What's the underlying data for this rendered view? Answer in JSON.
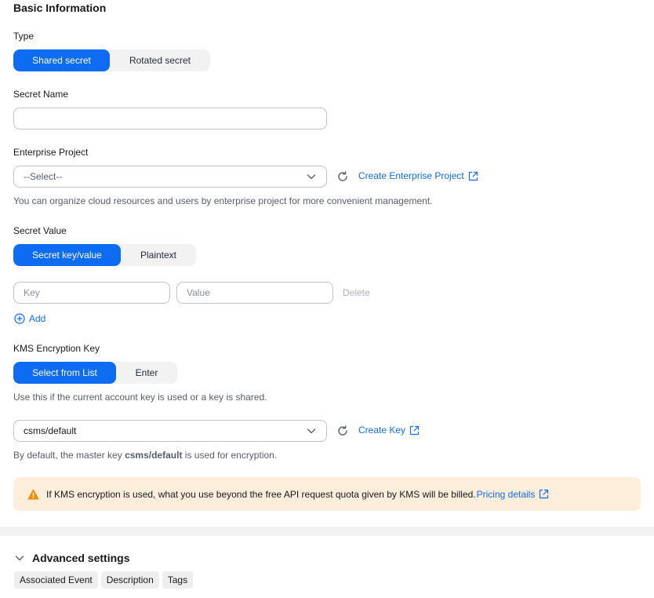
{
  "section_title": "Basic Information",
  "type": {
    "label": "Type",
    "options": [
      "Shared secret",
      "Rotated secret"
    ],
    "selected": "Shared secret"
  },
  "secret_name": {
    "label": "Secret Name",
    "value": "",
    "placeholder": ""
  },
  "enterprise_project": {
    "label": "Enterprise Project",
    "value": "--Select--",
    "create_link": "Create Enterprise Project",
    "hint": "You can organize cloud resources and users by enterprise project for more convenient management."
  },
  "secret_value": {
    "label": "Secret Value",
    "options": [
      "Secret key/value",
      "Plaintext"
    ],
    "selected": "Secret key/value",
    "key_placeholder": "Key",
    "value_placeholder": "Value",
    "delete_label": "Delete",
    "add_label": "Add"
  },
  "kms_key": {
    "label": "KMS Encryption Key",
    "options": [
      "Select from List",
      "Enter"
    ],
    "selected": "Select from List",
    "hint": "Use this if the current account key is used or a key is shared.",
    "value": "csms/default",
    "create_link": "Create Key",
    "default_hint_prefix": "By default, the master key ",
    "default_hint_key": "csms/default",
    "default_hint_suffix": " is used for encryption."
  },
  "banner": {
    "text": "If KMS encryption is used, what you use beyond the free API request quota given by KMS will be billed.",
    "link": "Pricing details"
  },
  "advanced": {
    "title": "Advanced settings",
    "tags": [
      "Associated Event",
      "Description",
      "Tags"
    ]
  },
  "colors": {
    "accent": "#0d6cf2",
    "warning": "#f28c00",
    "banner_bg": "#fdeedc"
  }
}
